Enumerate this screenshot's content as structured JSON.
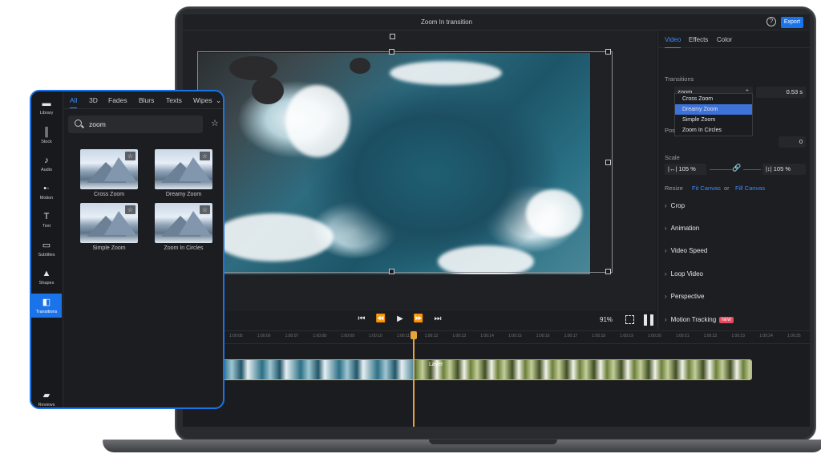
{
  "editor": {
    "title": "Zoom In transition",
    "export_label": "Export",
    "zoom_level": "91%"
  },
  "props": {
    "tabs": [
      "Video",
      "Effects",
      "Color"
    ],
    "transitions_label": "Transitions",
    "transition_search": "zoom",
    "duration": "0.53 s",
    "dropdown": [
      "Cross Zoom",
      "Dreamy Zoom",
      "Simple Zoom",
      "Zoom In Circles"
    ],
    "dropdown_selected": "Dreamy Zoom",
    "position_label": "Pos",
    "rotation_value": "0",
    "scale_label": "Scale",
    "scale_w": "105 %",
    "scale_h": "105 %",
    "resize_label": "Resize",
    "fit_canvas": "Fit Canvas",
    "or": "or",
    "fill_canvas": "Fill Canvas",
    "sections": [
      "Crop",
      "Animation",
      "Video Speed",
      "Loop Video",
      "Perspective",
      "Motion Tracking"
    ],
    "new_badge": "NEW"
  },
  "timeline": {
    "ticks": [
      "1:00:05",
      "1:00:06",
      "1:00:07",
      "1:00:08",
      "1:00:09",
      "1:00:10",
      "1:00:11",
      "1:00:12",
      "1:00:13",
      "1:00:14",
      "1:00:15",
      "1:00:16",
      "1:00:17",
      "1:00:18",
      "1:00:19",
      "1:00:20",
      "1:00:21",
      "1:00:22",
      "1:00:23",
      "1:00:24",
      "1:00:25"
    ],
    "clip_label": "Layer"
  },
  "panel": {
    "sidebar": [
      {
        "label": "Library",
        "icon": "folder-icon"
      },
      {
        "label": "Stock",
        "icon": "books-icon"
      },
      {
        "label": "Audio",
        "icon": "music-icon"
      },
      {
        "label": "Motion",
        "icon": "motion-icon"
      },
      {
        "label": "Text",
        "icon": "text-icon"
      },
      {
        "label": "Subtitles",
        "icon": "subtitles-icon"
      },
      {
        "label": "Shapes",
        "icon": "shapes-icon"
      },
      {
        "label": "Transitions",
        "icon": "transitions-icon"
      },
      {
        "label": "Reviews",
        "icon": "chat-icon"
      }
    ],
    "tabs": [
      "All",
      "3D",
      "Fades",
      "Blurs",
      "Texts",
      "Wipes"
    ],
    "search_value": "zoom",
    "items": [
      "Cross Zoom",
      "Dreamy Zoom",
      "Simple Zoom",
      "Zoom In Circles"
    ]
  }
}
